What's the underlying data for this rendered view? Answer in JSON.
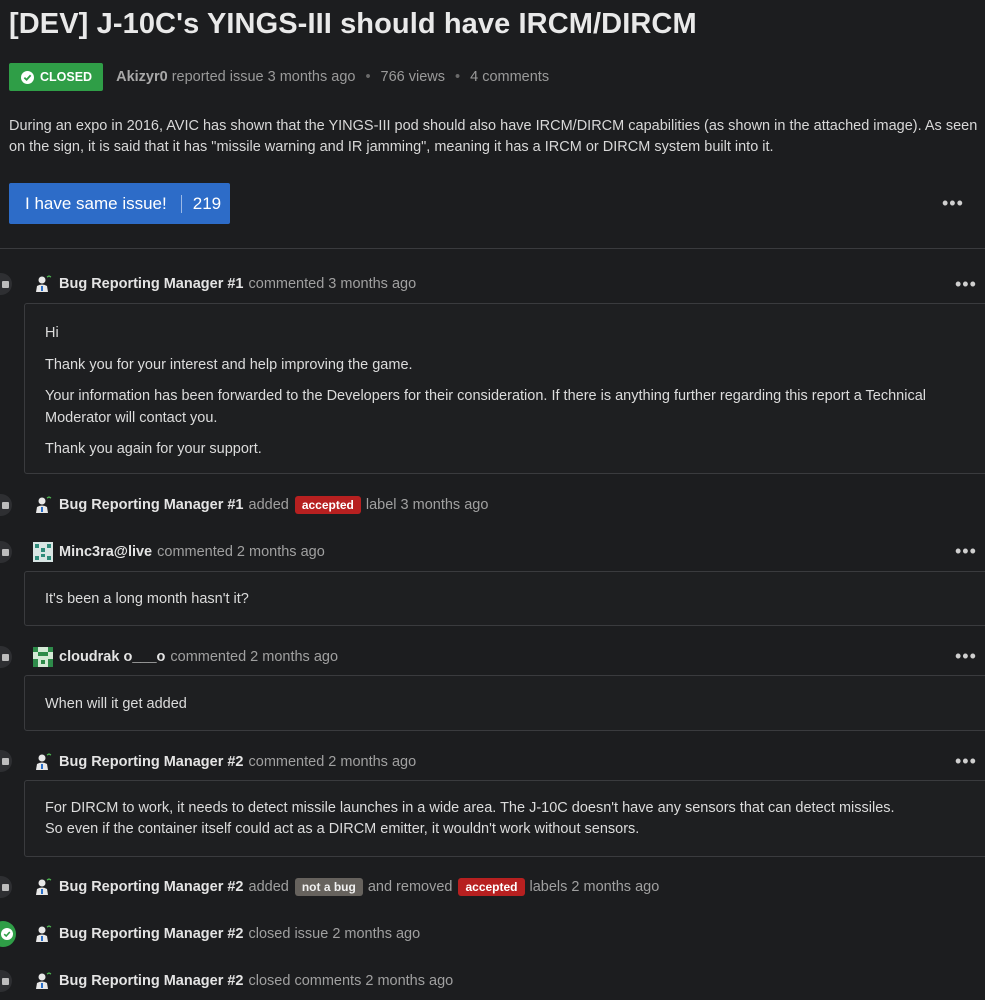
{
  "issue": {
    "title": "[DEV] J-10C's YINGS-III should have IRCM/DIRCM",
    "status": "CLOSED",
    "author": "Akizyr0",
    "reported_text": "reported issue 3 months ago",
    "views": "766 views",
    "comments_count": "4 comments",
    "description": "During an expo in 2016, AVIC has shown that the YINGS-III pod should also have IRCM/DIRCM capabilities (as shown in the attached image). As seen on the sign, it is said that it has \"missile warning and IR jamming\", meaning it has a IRCM or DIRCM system built into it.",
    "same_issue_label": "I have same issue!",
    "same_issue_count": "219",
    "more_label": "•••"
  },
  "timeline": {
    "c1": {
      "user": "Bug Reporting Manager #1",
      "action": "commented 3 months ago",
      "p1": "Hi",
      "p2": "Thank you for your interest and help improving the game.",
      "p3": "Your information has been forwarded to the Developers for their consideration. If there is anything further regarding this report a Technical Moderator will contact you.",
      "p4": "Thank you again for your support."
    },
    "e1": {
      "user": "Bug Reporting Manager #1",
      "pre": "added",
      "label": "accepted",
      "post": "label 3 months ago"
    },
    "c2": {
      "user": "Minc3ra@live",
      "action": "commented 2 months ago",
      "body": "It's been a long month hasn't it?"
    },
    "c3": {
      "user": "cloudrak o___o",
      "action": "commented 2 months ago",
      "body": "When will it get added"
    },
    "c4": {
      "user": "Bug Reporting Manager #2",
      "action": "commented 2 months ago",
      "line1": "For DIRCM to work, it needs to detect missile launches in a wide area. The J-10C doesn't have any sensors that can detect missiles.",
      "line2": "So even if the container itself could act as a DIRCM emitter, it wouldn't work without sensors."
    },
    "e2": {
      "user": "Bug Reporting Manager #2",
      "pre": "added",
      "label1": "not a bug",
      "mid": "and removed",
      "label2": "accepted",
      "post": "labels 2 months ago"
    },
    "e3": {
      "user": "Bug Reporting Manager #2",
      "action": "closed issue 2 months ago"
    },
    "e4": {
      "user": "Bug Reporting Manager #2",
      "action": "closed comments 2 months ago"
    }
  },
  "colors": {
    "closed": "#2f9e47",
    "button": "#2d6cc8",
    "accepted": "#b72020",
    "not_a_bug": "#66625d",
    "background": "#1c1d1f"
  }
}
